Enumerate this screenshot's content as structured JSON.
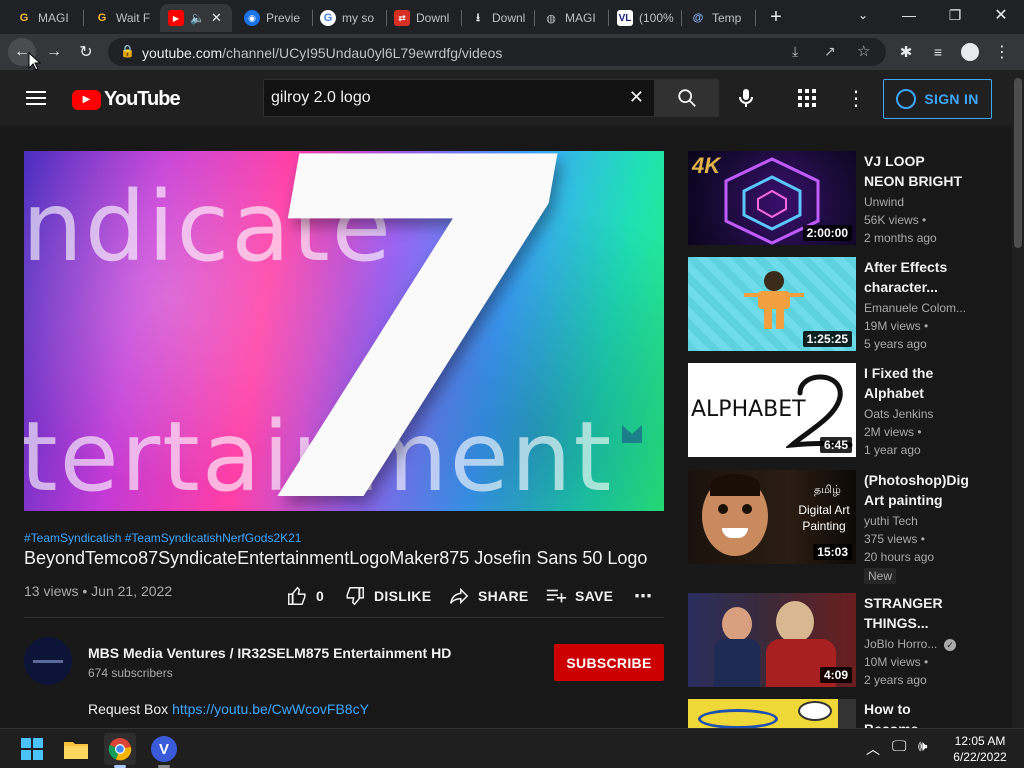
{
  "browser": {
    "tabs": [
      {
        "label": "MAGI"
      },
      {
        "label": "Wait F"
      },
      {
        "label": ""
      },
      {
        "label": "Previe"
      },
      {
        "label": "my so"
      },
      {
        "label": "Downl"
      },
      {
        "label": "Downl"
      },
      {
        "label": "MAGI"
      },
      {
        "label": "(100%"
      },
      {
        "label": "Temp"
      }
    ],
    "url_domain": "youtube.com",
    "url_path": "/channel/UCyI95Undau0yl6L79ewrdfg/videos"
  },
  "youtube": {
    "logo_text": "YouTube",
    "search_query": "gilroy 2.0 logo",
    "sign_in_label": "SIGN IN"
  },
  "video": {
    "thumb_word_top": "ndicate",
    "thumb_word_bottom": "tertainment",
    "thumb_big_digit": "7",
    "hashtags": "#TeamSyndicatish #TeamSyndicatishNerfGods2K21",
    "title": "BeyondTemco87SyndicateEntertainmentLogoMaker875 Josefin Sans 50 Logo",
    "views": "13 views",
    "date": "Jun 21, 2022",
    "likes": "0",
    "dislike_label": "DISLIKE",
    "share_label": "SHARE",
    "save_label": "SAVE"
  },
  "channel": {
    "name": "MBS Media Ventures / IR32SELM875 Entertainment HD",
    "subscribers": "674 subscribers",
    "subscribe_label": "SUBSCRIBE",
    "description_prefix": "Request Box",
    "description_link": "https://youtu.be/CwWcovFB8cY"
  },
  "recommendations": [
    {
      "title": "VJ LOOP NEON BRIGHT LIGH...",
      "channel": "Unwind",
      "views": "56K views •",
      "age": "2 months ago",
      "duration": "2:00:00"
    },
    {
      "title": "After Effects character...",
      "channel": "Emanuele Colom...",
      "views": "19M views •",
      "age": "5 years ago",
      "duration": "1:25:25"
    },
    {
      "title": "I Fixed the Alphabet",
      "channel": "Oats Jenkins",
      "views": "2M views •",
      "age": "1 year ago",
      "duration": "6:45",
      "thumb_text": "ALPHABET"
    },
    {
      "title": "(Photoshop)Digi Art painting in...",
      "channel": "yuthi Tech",
      "views": "375 views •",
      "age": "20 hours ago",
      "duration": "15:03",
      "badge": "New",
      "thumb_text_1": "தமிழ்",
      "thumb_text_2": "Digital Art Painting"
    },
    {
      "title": "STRANGER THINGS...",
      "channel": "JoBlo Horro...",
      "views": "10M views •",
      "age": "2 years ago",
      "duration": "4:09"
    },
    {
      "title": "How to Become",
      "channel": "",
      "views": "",
      "age": "",
      "duration": ""
    }
  ],
  "taskbar": {
    "time": "12:05 AM",
    "date": "6/22/2022"
  },
  "colors": {
    "accent_blue": "#3ea6ff",
    "subscribe_red": "#cc0000",
    "yt_red": "#ff0000"
  }
}
